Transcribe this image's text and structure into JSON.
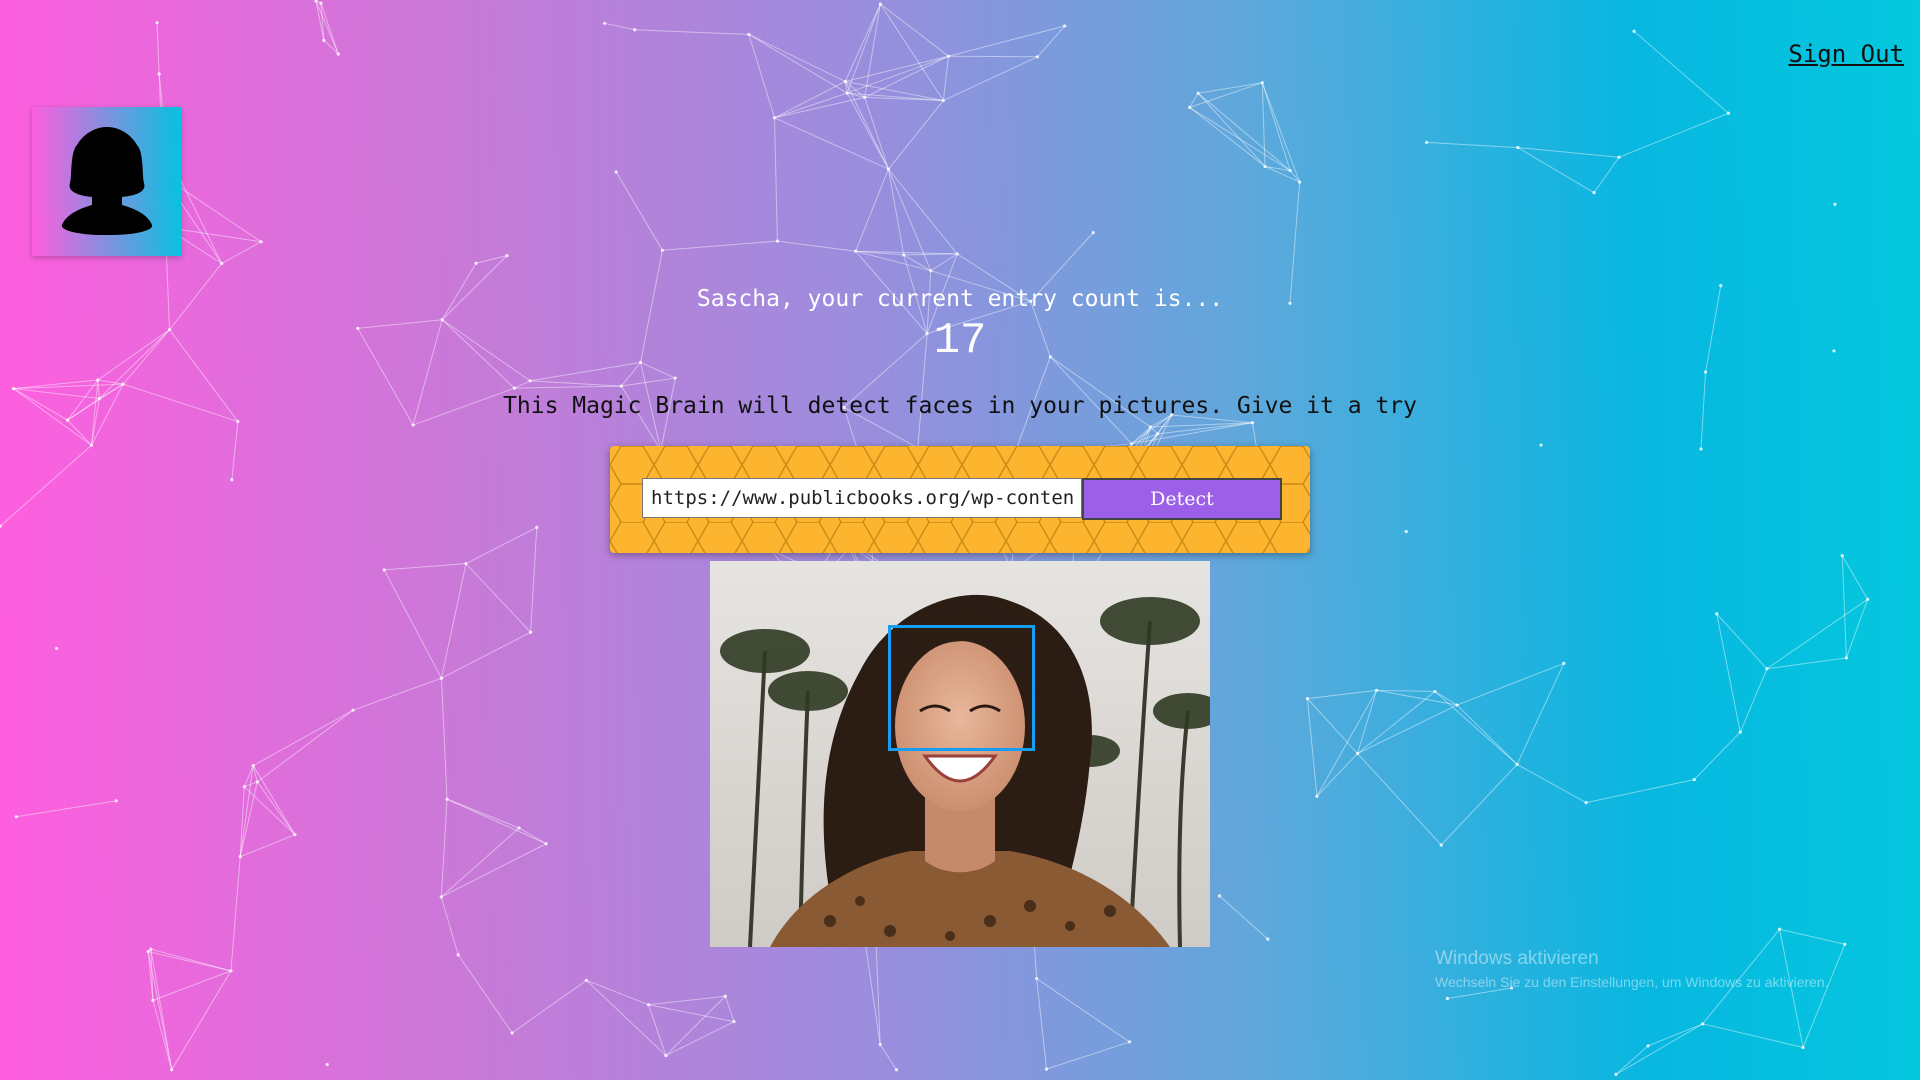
{
  "header": {
    "signout_label": "Sign Out"
  },
  "logo": {
    "icon": "user-silhouette-icon"
  },
  "rank": {
    "message": "Sascha, your current entry count is...",
    "count": "17"
  },
  "intro": {
    "text": "This Magic Brain will detect faces in your pictures. Give it a try"
  },
  "form": {
    "url_value": "https://www.publicbooks.org/wp-content",
    "detect_label": "Detect"
  },
  "result": {
    "image_alt": "Smiling woman with dark hair in front of palm trees",
    "faces_detected": 1
  },
  "os_watermark": {
    "title": "Windows aktivieren",
    "subtitle": "Wechseln Sie zu den Einstellungen, um Windows zu aktivieren."
  },
  "colors": {
    "gradient_left": "#ff5edf",
    "gradient_right": "#04c8de",
    "panel": "#fdb52f",
    "button": "#9c5fe7",
    "face_box": "#149df2"
  }
}
